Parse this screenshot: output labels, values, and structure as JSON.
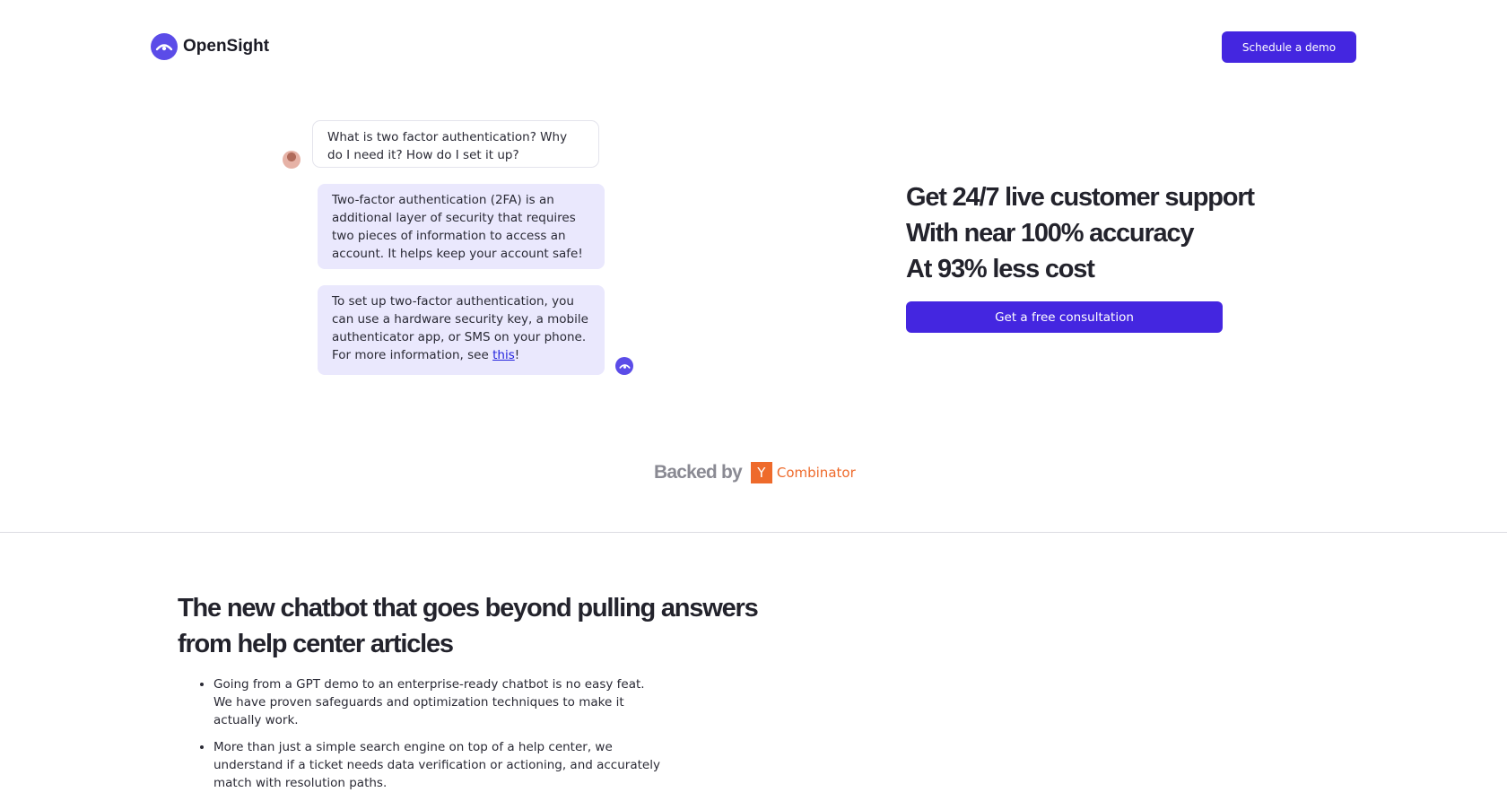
{
  "header": {
    "brand": "OpenSight",
    "demo_button": "Schedule a demo"
  },
  "chat": {
    "question": "What is two factor authentication? Why do I need it? How do I set it up?",
    "answer1": "Two-factor authentication (2FA) is an additional layer of security that requires two pieces of information to access an account. It helps keep your account safe!",
    "answer2_text": "To set up two-factor authentication, you can use a hardware security key, a mobile authenticator app, or SMS on your phone. For more information, see ",
    "answer2_link": "this",
    "answer2_end": "!"
  },
  "hero": {
    "line1": "Get 24/7 live customer support",
    "line2": "With near 100% accuracy",
    "line3": "At 93% less cost",
    "cta": "Get a free consultation"
  },
  "backed": {
    "label": "Backed by",
    "yc_letter": "Y",
    "yc_name": "Combinator"
  },
  "section": {
    "title_line1": "The new chatbot that goes beyond pulling answers",
    "title_line2": "from help center articles",
    "bullets": [
      "Going from a GPT demo to an enterprise-ready chatbot is no easy feat. We have proven safeguards and optimization techniques to make it actually work.",
      "More than just a simple search engine on top of a help center, we understand if a ticket needs data verification or actioning, and accurately match with resolution paths."
    ]
  },
  "colors": {
    "accent": "#4426e0",
    "logo": "#5b4ce8",
    "bubble_bg": "#eae8fd",
    "yc_orange": "#ee6a2b"
  },
  "icons": {
    "logo": "eye-arc-icon",
    "user_avatar": "user-avatar-icon",
    "bot_avatar": "bot-avatar-icon"
  }
}
